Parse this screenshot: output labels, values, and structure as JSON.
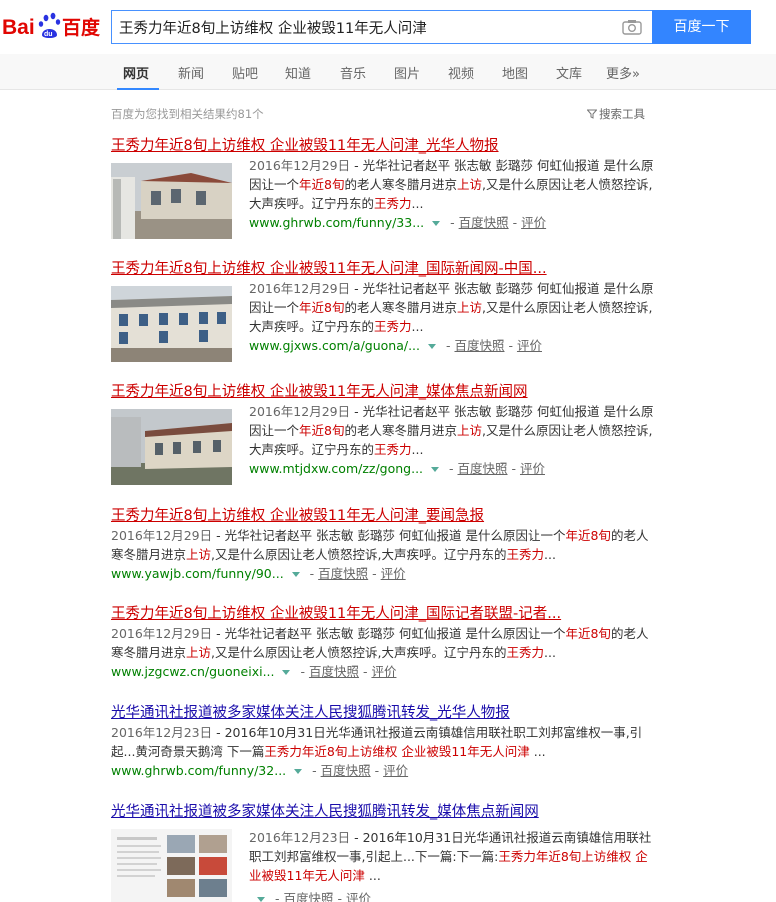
{
  "header": {
    "logo_text": "Bai百度",
    "query": "王秀力年近8旬上访维权 企业被毁11年无人问津",
    "search_button": "百度一下"
  },
  "tabs": [
    "网页",
    "新闻",
    "贴吧",
    "知道",
    "音乐",
    "图片",
    "视频",
    "地图",
    "文库",
    "更多»"
  ],
  "stats": "百度为您找到相关结果约81个",
  "tools": "搜索工具",
  "results": [
    {
      "title": "王秀力年近8旬上访维权 企业被毁11年无人问津_光华人物报",
      "date": "2016年12月29日",
      "snippet": [
        {
          "t": " - 光华社记者赵平 张志敏 彭璐莎 何虹仙报道 是什么原因让一个",
          "h": false
        },
        {
          "t": "年近8旬",
          "h": true
        },
        {
          "t": "的老人寒冬腊月进京",
          "h": false
        },
        {
          "t": "上访",
          "h": true
        },
        {
          "t": ",又是什么原因让老人愤怒控诉,大声疾呼。辽宁丹东的",
          "h": false
        },
        {
          "t": "王秀力",
          "h": true
        },
        {
          "t": "...",
          "h": false
        }
      ],
      "url": "www.ghrwb.com/funny/33...",
      "snapshot": "百度快照",
      "review": "评价"
    },
    {
      "title": "王秀力年近8旬上访维权 企业被毁11年无人问津_国际新闻网-中国...",
      "date": "2016年12月29日",
      "snippet": [
        {
          "t": " - 光华社记者赵平 张志敏 彭璐莎 何虹仙报道 是什么原因让一个",
          "h": false
        },
        {
          "t": "年近8旬",
          "h": true
        },
        {
          "t": "的老人寒冬腊月进京",
          "h": false
        },
        {
          "t": "上访",
          "h": true
        },
        {
          "t": ",又是什么原因让老人愤怒控诉,大声疾呼。辽宁丹东的",
          "h": false
        },
        {
          "t": "王秀力",
          "h": true
        },
        {
          "t": "...",
          "h": false
        }
      ],
      "url": "www.gjxws.com/a/guona/...",
      "snapshot": "百度快照",
      "review": "评价"
    },
    {
      "title": "王秀力年近8旬上访维权 企业被毁11年无人问津_媒体焦点新闻网",
      "date": "2016年12月29日",
      "snippet": [
        {
          "t": " - 光华社记者赵平 张志敏 彭璐莎 何虹仙报道 是什么原因让一个",
          "h": false
        },
        {
          "t": "年近8旬",
          "h": true
        },
        {
          "t": "的老人寒冬腊月进京",
          "h": false
        },
        {
          "t": "上访",
          "h": true
        },
        {
          "t": ",又是什么原因让老人愤怒控诉,大声疾呼。辽宁丹东的",
          "h": false
        },
        {
          "t": "王秀力",
          "h": true
        },
        {
          "t": "...",
          "h": false
        }
      ],
      "url": "www.mtjdxw.com/zz/gong...",
      "snapshot": "百度快照",
      "review": "评价"
    },
    {
      "title": "王秀力年近8旬上访维权 企业被毁11年无人问津_要闻急报",
      "date": "2016年12月29日",
      "snippet": [
        {
          "t": " - 光华社记者赵平 张志敏 彭璐莎 何虹仙报道 是什么原因让一个",
          "h": false
        },
        {
          "t": "年近8旬",
          "h": true
        },
        {
          "t": "的老人寒冬腊月进京",
          "h": false
        },
        {
          "t": "上访",
          "h": true
        },
        {
          "t": ",又是什么原因让老人愤怒控诉,大声疾呼。辽宁丹东的",
          "h": false
        },
        {
          "t": "王秀力",
          "h": true
        },
        {
          "t": "...",
          "h": false
        }
      ],
      "url": "www.yawjb.com/funny/90...",
      "snapshot": "百度快照",
      "review": "评价"
    },
    {
      "title": "王秀力年近8旬上访维权 企业被毁11年无人问津_国际记者联盟-记者...",
      "date": "2016年12月29日",
      "snippet": [
        {
          "t": " - 光华社记者赵平 张志敏 彭璐莎 何虹仙报道 是什么原因让一个",
          "h": false
        },
        {
          "t": "年近8旬",
          "h": true
        },
        {
          "t": "的老人寒冬腊月进京",
          "h": false
        },
        {
          "t": "上访",
          "h": true
        },
        {
          "t": ",又是什么原因让老人愤怒控诉,大声疾呼。辽宁丹东的",
          "h": false
        },
        {
          "t": "王秀力",
          "h": true
        },
        {
          "t": "...",
          "h": false
        }
      ],
      "url": "www.jzgcwz.cn/guoneixi...",
      "snapshot": "百度快照",
      "review": "评价"
    },
    {
      "title": "光华通讯社报道被多家媒体关注人民搜狐腾讯转发_光华人物报",
      "date": "2016年12月23日",
      "snippet": [
        {
          "t": " - 2016年10月31日光华通讯社报道云南镇雄信用联社职工刘邦富维权一事,引起...黄河奇景天鹅湾 下一篇",
          "h": false
        },
        {
          "t": "王秀力年近8旬上访维权 企业被毁11年无人问津",
          "h": true
        },
        {
          "t": " ...",
          "h": false
        }
      ],
      "url": "www.ghrwb.com/funny/32...",
      "snapshot": "百度快照",
      "review": "评价"
    },
    {
      "title": "光华通讯社报道被多家媒体关注人民搜狐腾讯转发_媒体焦点新闻网",
      "date": "2016年12月23日",
      "snippet": [
        {
          "t": " - 2016年10月31日光华通讯社报道云南镇雄信用联社职工刘邦富维权一事,引起上...下一篇:下一篇:",
          "h": false
        },
        {
          "t": "王秀力年近8旬上访维权 企业被毁11年无人问津",
          "h": true
        },
        {
          "t": " ...",
          "h": false
        }
      ],
      "url": "",
      "snapshot": "百度快照",
      "review": "评价"
    }
  ],
  "colors": {
    "accent": "#3385ff",
    "title_red": "#cc0000",
    "title_blue": "#1a0dab",
    "url_green": "#008000"
  }
}
